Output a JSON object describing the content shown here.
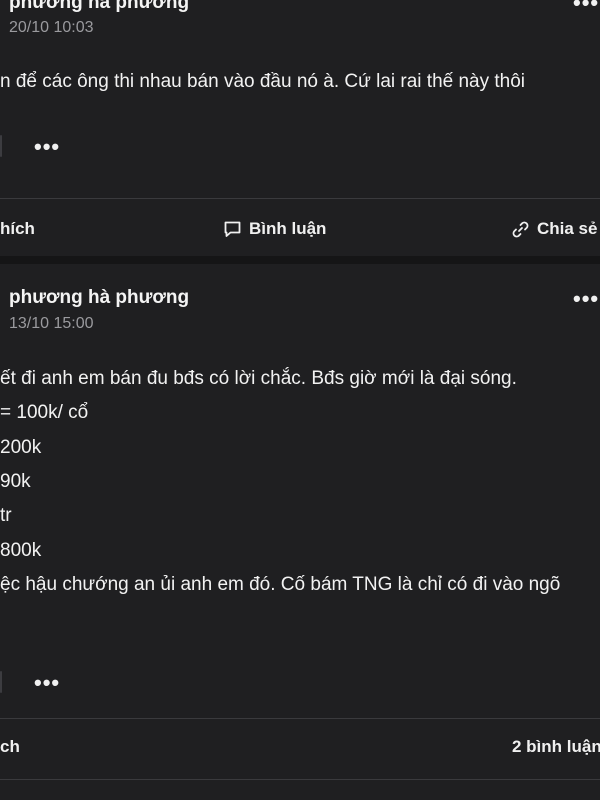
{
  "post1": {
    "author": "phương hà phương",
    "time": "20/10 10:03",
    "lines": [
      "n để các ông thi nhau bán vào đầu nó à. Cứ lai rai thế này thôi"
    ],
    "more_label": "•••",
    "actions": {
      "like": "hích",
      "comment": "Bình luận",
      "share": "Chia sẻ"
    }
  },
  "post2": {
    "author": "phương hà phương",
    "time": "13/10 15:00",
    "lines": [
      "ết đi anh em bán đu bđs có lời chắc. Bđs giờ mới là đại sóng.",
      "= 100k/ cổ",
      "200k",
      "90k",
      "tr",
      " 800k",
      "ệc hậu chướng an ủi anh em đó. Cố bám TNG là chỉ có đi vào ngõ"
    ],
    "more_label": "•••",
    "like_partial": "ch",
    "comments_count": "2 bình luận"
  },
  "icons": {
    "more": "more-dots-icon",
    "comment": "comment-bubble-icon",
    "share": "link-chain-icon"
  },
  "colors": {
    "background": "#1f1f21",
    "text": "#f2f2f2",
    "muted": "#9a9a9e",
    "divider": "#3a3a3d"
  }
}
